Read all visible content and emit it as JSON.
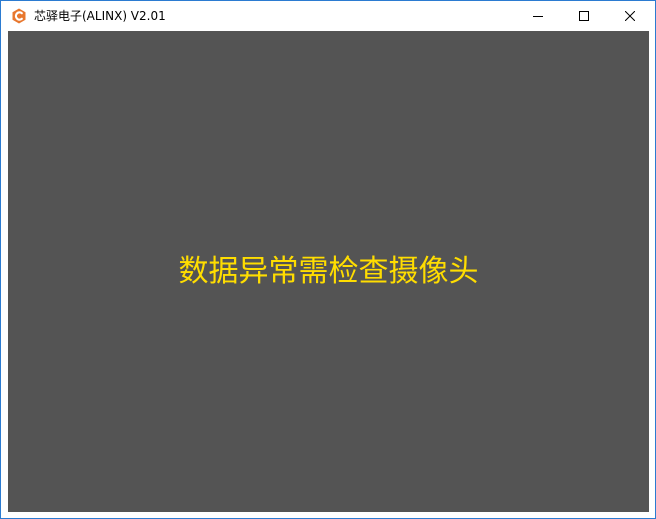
{
  "window": {
    "title": "芯驿电子(ALINX) V2.01",
    "app_icon": "alinx-logo-icon",
    "controls": {
      "minimize_icon": "minimize-icon",
      "maximize_icon": "maximize-icon",
      "close_icon": "close-icon"
    }
  },
  "main": {
    "message": "数据异常需检查摄像头"
  },
  "colors": {
    "border": "#2b7bd1",
    "titlebar_bg": "#ffffff",
    "content_bg": "#545454",
    "message_text": "#ffdd00",
    "icon_orange": "#e8772e"
  }
}
